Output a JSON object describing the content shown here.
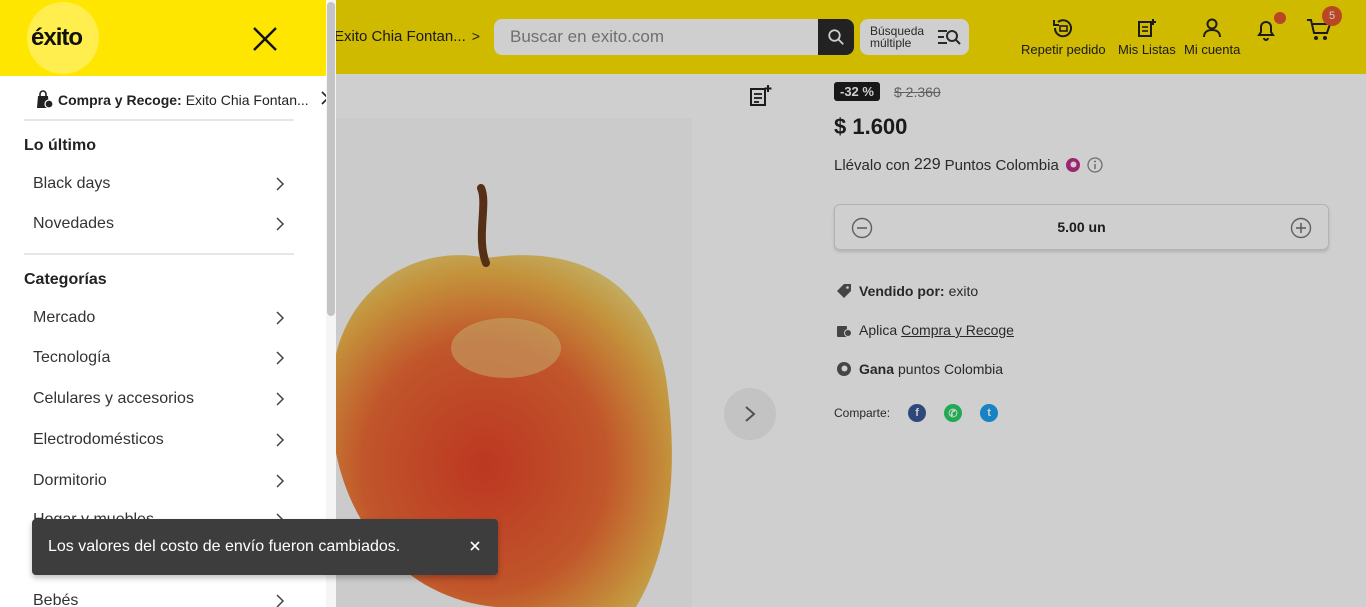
{
  "header": {
    "location_label": "Exito Chia Fontan...",
    "search_placeholder": "Buscar en exito.com",
    "bulk_search_label": "Búsqueda múltiple",
    "repeat_order_label": "Repetir pedido",
    "my_lists_label": "Mis Listas",
    "my_account_label": "Mi cuenta",
    "cart_count": "5"
  },
  "product": {
    "discount_badge": "-32 %",
    "old_price": "$ 2.360",
    "price": "$ 1.600",
    "points_prefix": "Llévalo con",
    "points_value": "229",
    "points_suffix": "Puntos Colombia",
    "quantity": "5.00 un",
    "sold_by_label": "Vendido por:",
    "sold_by_value": "exito",
    "applies_prefix": "Aplica",
    "applies_link": "Compra y Recoge",
    "earn_label": "Gana",
    "earn_suffix": "puntos Colombia",
    "share_label": "Comparte:"
  },
  "drawer": {
    "logo_text": "éxito",
    "pickup_label": "Compra y Recoge:",
    "pickup_store": "Exito Chia Fontan...",
    "sections": [
      {
        "title": "Lo último",
        "items": [
          "Black days",
          "Novedades"
        ]
      },
      {
        "title": "Categorías",
        "items": [
          "Mercado",
          "Tecnología",
          "Celulares y accesorios",
          "Electrodomésticos",
          "Dormitorio",
          "Hogar y muebles",
          "Bebés"
        ]
      }
    ]
  },
  "toast": {
    "message": "Los valores del costo de envío fueron cambiados."
  },
  "colors": {
    "brand_yellow": "#FFE600",
    "toast_bg": "#3D3D3D",
    "badge_orange": "#E4572E"
  }
}
